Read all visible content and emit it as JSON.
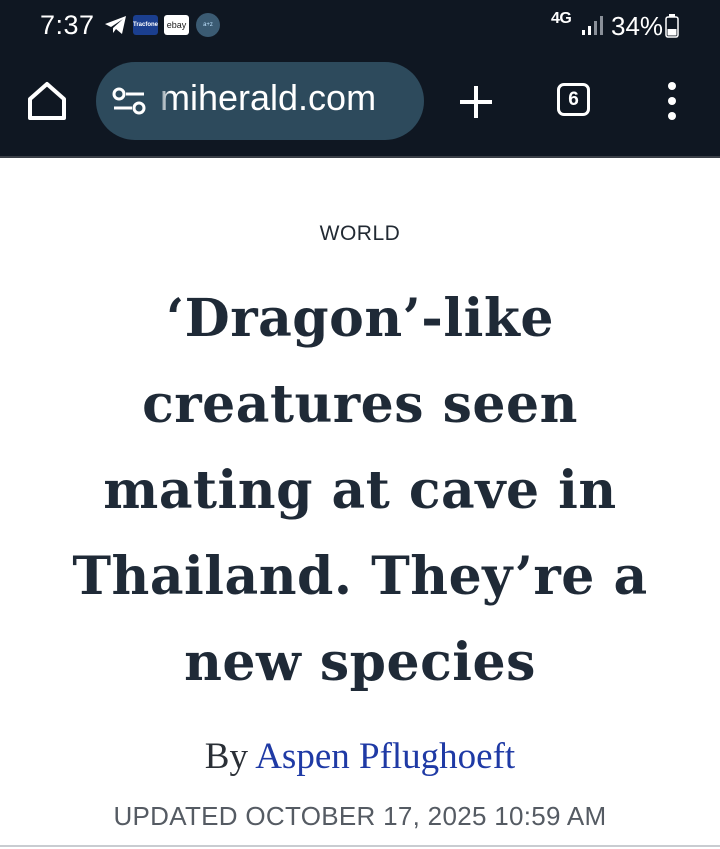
{
  "status_bar": {
    "time": "7:37",
    "notification_icons": [
      "telegram-icon",
      "tracfone-icon",
      "ebay-icon",
      "sports-app-icon"
    ],
    "tracfone_label": "Tracfone",
    "ebay_label": "ebay",
    "sports_label": "a+z",
    "network": "4G",
    "battery": "34%"
  },
  "toolbar": {
    "url": "miherald.com",
    "tab_count": "6"
  },
  "article": {
    "section": "WORLD",
    "headline": "‘Dragon’-like creatures seen mating at cave in Thailand. They’re a new species",
    "byline_prefix": "By",
    "author": "Aspen Pflughoeft",
    "updated": "UPDATED OCTOBER 17, 2025 10:59 AM"
  },
  "colors": {
    "chrome_background": "#0f1722",
    "url_bar": "#2d4a5c",
    "headline": "#1f2a37",
    "author_link": "#1f3aa5"
  }
}
